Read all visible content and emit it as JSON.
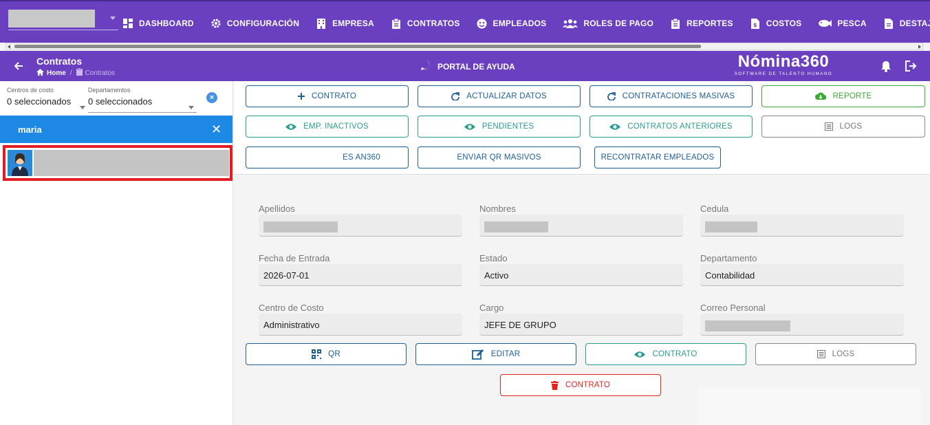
{
  "nav": {
    "items": [
      {
        "label": "DASHBOARD",
        "icon": "dashboard-icon"
      },
      {
        "label": "CONFIGURACIÓN",
        "icon": "gear-icon"
      },
      {
        "label": "EMPRESA",
        "icon": "building-icon"
      },
      {
        "label": "CONTRATOS",
        "icon": "clipboard-icon"
      },
      {
        "label": "EMPLEADOS",
        "icon": "employees-icon"
      },
      {
        "label": "ROLES DE PAGO",
        "icon": "users-icon"
      },
      {
        "label": "REPORTES",
        "icon": "clipboard-icon"
      },
      {
        "label": "COSTOS",
        "icon": "invoice-icon"
      },
      {
        "label": "PESCA",
        "icon": "fish-icon"
      },
      {
        "label": "DESTAJO",
        "icon": "file-icon"
      }
    ]
  },
  "subheader": {
    "title": "Contratos",
    "breadcrumb_home": "Home",
    "breadcrumb_current": "Contratos",
    "help_label": "PORTAL DE AYUDA",
    "logo_main": "Nómina360",
    "logo_tagline": "SOFTWARE DE TALENTO HUMANO"
  },
  "filters": {
    "cost_center_label": "Centros de costo",
    "cost_center_value": "0 seleccionados",
    "department_label": "Departamentos",
    "department_value": "0 seleccionados"
  },
  "search": {
    "value": "maria"
  },
  "actions": {
    "contrato": "CONTRATO",
    "actualizar": "ACTUALIZAR DATOS",
    "masivas": "CONTRATACIONES MASIVAS",
    "reporte": "REPORTE",
    "inactivos": "EMP. INACTIVOS",
    "pendientes": "PENDIENTES",
    "anteriores": "CONTRATOS ANTERIORES",
    "logs": "LOGS",
    "an360": "ES AN360",
    "qr_masivos": "ENVIAR QR MASIVOS",
    "recontratar": "RECONTRATAR EMPLEADOS"
  },
  "detail": {
    "apellidos_label": "Apellidos",
    "nombres_label": "Nombres",
    "cedula_label": "Cedula",
    "fecha_label": "Fecha de Entrada",
    "fecha_value": "2026-07-01",
    "estado_label": "Estado",
    "estado_value": "Activo",
    "departamento_label": "Departamento",
    "departamento_value": "Contabilidad",
    "centro_label": "Centro de Costo",
    "centro_value": "Administrativo",
    "cargo_label": "Cargo",
    "cargo_value": "JEFE DE GRUPO",
    "correo_label": "Correo Personal"
  },
  "detail_actions": {
    "qr": "QR",
    "editar": "EDITAR",
    "contrato": "CONTRATO",
    "logs": "LOGS",
    "eliminar": "CONTRATO"
  },
  "colors": {
    "primary": "#6a3fc0",
    "search": "#1e88e5",
    "highlight": "#e41b23"
  }
}
